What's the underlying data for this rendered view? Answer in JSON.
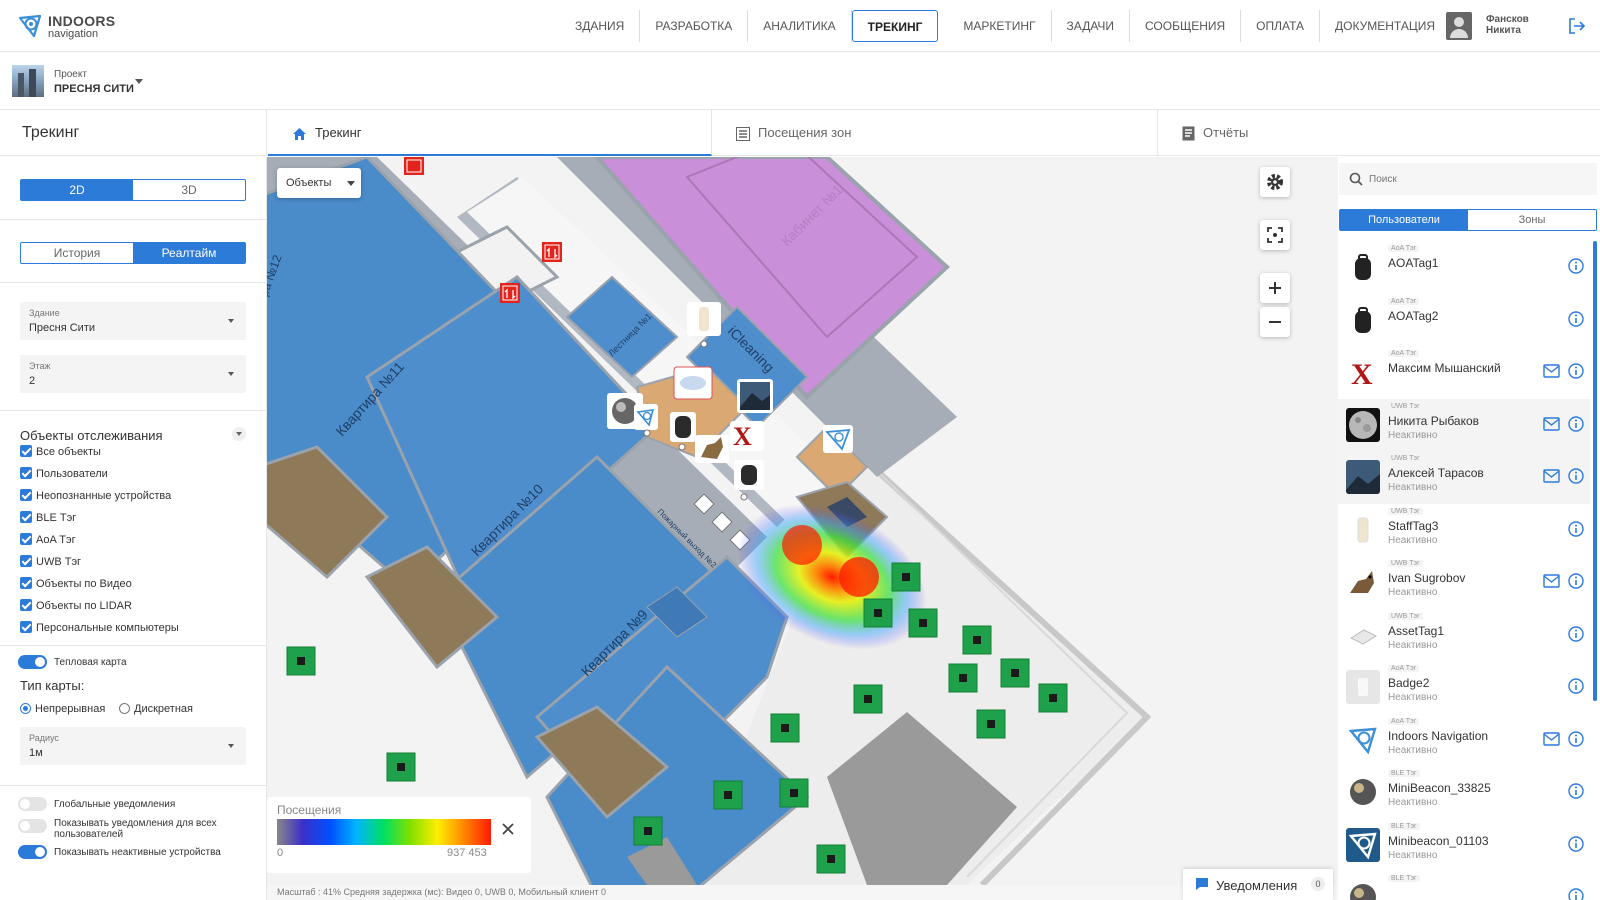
{
  "brand": {
    "line1": "INDOORS",
    "line2": "navigation",
    "color": "#3a8fd6"
  },
  "nav": [
    "ЗДАНИЯ",
    "РАЗРАБОТКА",
    "АНАЛИТИКА",
    "ТРЕКИНГ",
    "МАРКЕТИНГ",
    "ЗАДАЧИ",
    "СООБЩЕНИЯ",
    "ОПЛАТА",
    "ДОКУМЕНТАЦИЯ"
  ],
  "nav_active": "ТРЕКИНГ",
  "user": {
    "first": "Фансков",
    "last": "Никита"
  },
  "project": {
    "label": "Проект",
    "name": "ПРЕСНЯ СИТИ"
  },
  "page_title": "Трекинг",
  "tabs": [
    {
      "label": "Трекинг",
      "icon": "home-icon",
      "active": true
    },
    {
      "label": "Посещения зон",
      "icon": "list-icon",
      "active": false
    },
    {
      "label": "Отчёты",
      "icon": "report-icon",
      "active": false
    }
  ],
  "sidebar": {
    "view_2d": "2D",
    "view_3d": "3D",
    "mode_history": "История",
    "mode_realtime": "Реалтайм",
    "building_label": "Здание",
    "building_value": "Пресня Сити",
    "floor_label": "Этаж",
    "floor_value": "2",
    "objects_title": "Объекты отслеживания",
    "checkboxes": [
      "Все объекты",
      "Пользователи",
      "Неопознанные устройства",
      "BLE Тэг",
      "AoA Тэг",
      "UWB Тэг",
      "Объекты по Видео",
      "Объекты по LIDAR",
      "Персональные компьютеры"
    ],
    "heatmap_label": "Тепловая карта",
    "map_type_label": "Тип карты:",
    "map_type_cont": "Непрерывная",
    "map_type_disc": "Дискретная",
    "radius_label": "Радиус",
    "radius_value": "1м",
    "global_notif": "Глобальные уведомления",
    "show_notif_all": "Показывать уведомления для всех пользователей",
    "show_inactive": "Показывать неактивные устройства"
  },
  "map": {
    "objects_dropdown": "Объекты",
    "room_labels": [
      "Квартира №11",
      "Квартира №10",
      "Квартира №9",
      "Кабинет №1",
      "iCleaning",
      "Лестница №1",
      "Пожарный выход №2",
      "ра №12"
    ],
    "legend_title": "Посещения",
    "legend_min": "0",
    "legend_max": "937 453",
    "status": "Масштаб : 41%     Средняя задержка (мс): Видео 0, UWB 0, Мобильный клиент 0",
    "accent": "#2d7bd8"
  },
  "notifications": {
    "label": "Уведомления",
    "count": "0"
  },
  "right_panel": {
    "search_placeholder": "Поиск",
    "seg_users": "Пользователи",
    "seg_zones": "Зоны",
    "items": [
      {
        "type": "AoA Тэг",
        "name": "AOATag1",
        "status": "",
        "mail": false,
        "icon": "backpack-icon"
      },
      {
        "type": "AoA Тэг",
        "name": "AOATag2",
        "status": "",
        "mail": false,
        "icon": "backpack-icon"
      },
      {
        "type": "AoA Тэг",
        "name": "Максим Мышанский",
        "status": "",
        "mail": true,
        "icon": "x-logo-icon"
      },
      {
        "type": "UWB Тэг",
        "name": "Никита Рыбаков",
        "status": "Неактивно",
        "mail": true,
        "icon": "moon-avatar"
      },
      {
        "type": "UWB Тэг",
        "name": "Алексей Тарасов",
        "status": "Неактивно",
        "mail": true,
        "icon": "landscape-avatar"
      },
      {
        "type": "UWB Тэг",
        "name": "StaffTag3",
        "status": "Неактивно",
        "mail": false,
        "icon": "tag-device-icon"
      },
      {
        "type": "UWB Тэг",
        "name": "Ivan Sugrobov",
        "status": "Неактивно",
        "mail": true,
        "icon": "dog-avatar"
      },
      {
        "type": "UWB Тэг",
        "name": "AssetTag1",
        "status": "Неактивно",
        "mail": false,
        "icon": "asset-tag-icon"
      },
      {
        "type": "AoA Тэг",
        "name": "Badge2",
        "status": "Неактивно",
        "mail": false,
        "icon": "badge-icon"
      },
      {
        "type": "AoA Тэг",
        "name": "Indoors Navigation",
        "status": "Неактивно",
        "mail": true,
        "icon": "indoors-logo-icon"
      },
      {
        "type": "BLE Тэг",
        "name": "MiniBeacon_33825",
        "status": "Неактивно",
        "mail": false,
        "icon": "beacon-icon"
      },
      {
        "type": "BLE Тэг",
        "name": "Minibeacon_01103",
        "status": "Неактивно",
        "mail": false,
        "icon": "indoors-logo-dark-icon"
      },
      {
        "type": "BLE Тэг",
        "name": "",
        "status": "",
        "mail": false,
        "icon": "beacon-icon"
      }
    ]
  }
}
